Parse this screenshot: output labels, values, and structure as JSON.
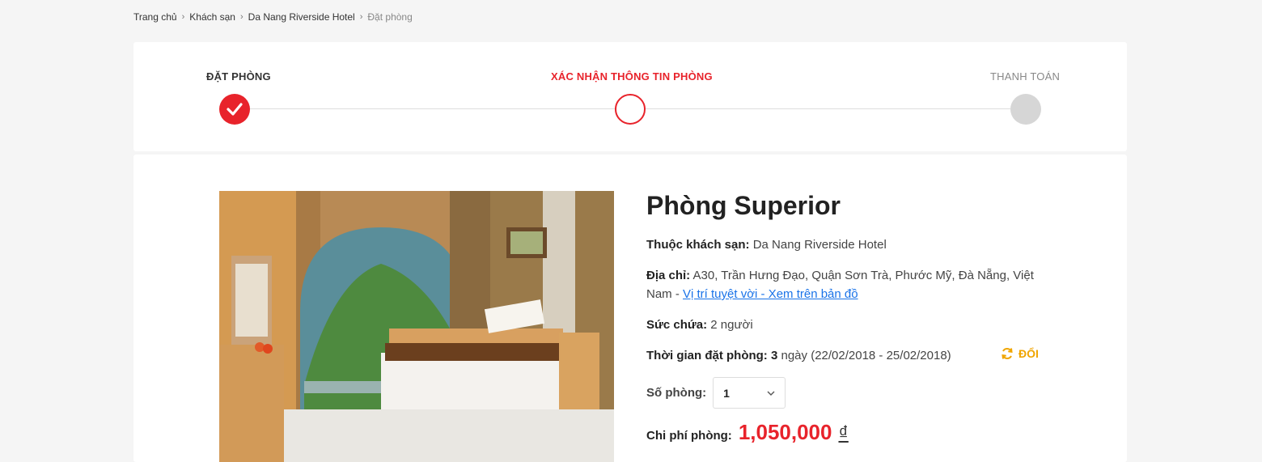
{
  "breadcrumb": {
    "items": [
      "Trang chủ",
      "Khách sạn",
      "Da Nang Riverside Hotel"
    ],
    "current": "Đặt phòng"
  },
  "steps": {
    "step1": "ĐẶT PHÒNG",
    "step2": "XÁC NHẬN THÔNG TIN PHÒNG",
    "step3": "THANH TOÁN"
  },
  "room": {
    "title": "Phòng Superior",
    "hotel_label": "Thuộc khách sạn:",
    "hotel_value": "Da Nang Riverside Hotel",
    "address_label": "Địa chỉ:",
    "address_value": "A30, Trần Hưng Đạo, Quận Sơn Trà, Phước Mỹ, Đà Nẵng, Việt Nam - ",
    "map_link": "Vị trí tuyệt vời - Xem trên bản đồ",
    "capacity_label": "Sức chứa:",
    "capacity_value": "2 người",
    "duration_label": "Thời gian đặt phòng:",
    "duration_days": "3",
    "duration_rest": "ngày (22/02/2018 - 25/02/2018)",
    "change_label": "ĐỔI",
    "rooms_label": "Số phòng:",
    "rooms_value": "1",
    "cost_label": "Chi phí phòng:",
    "cost_value": "1,050,000",
    "cost_currency": "₫"
  },
  "colors": {
    "accent": "#e8232b",
    "link": "#1a73e8",
    "change": "#f0a500"
  }
}
